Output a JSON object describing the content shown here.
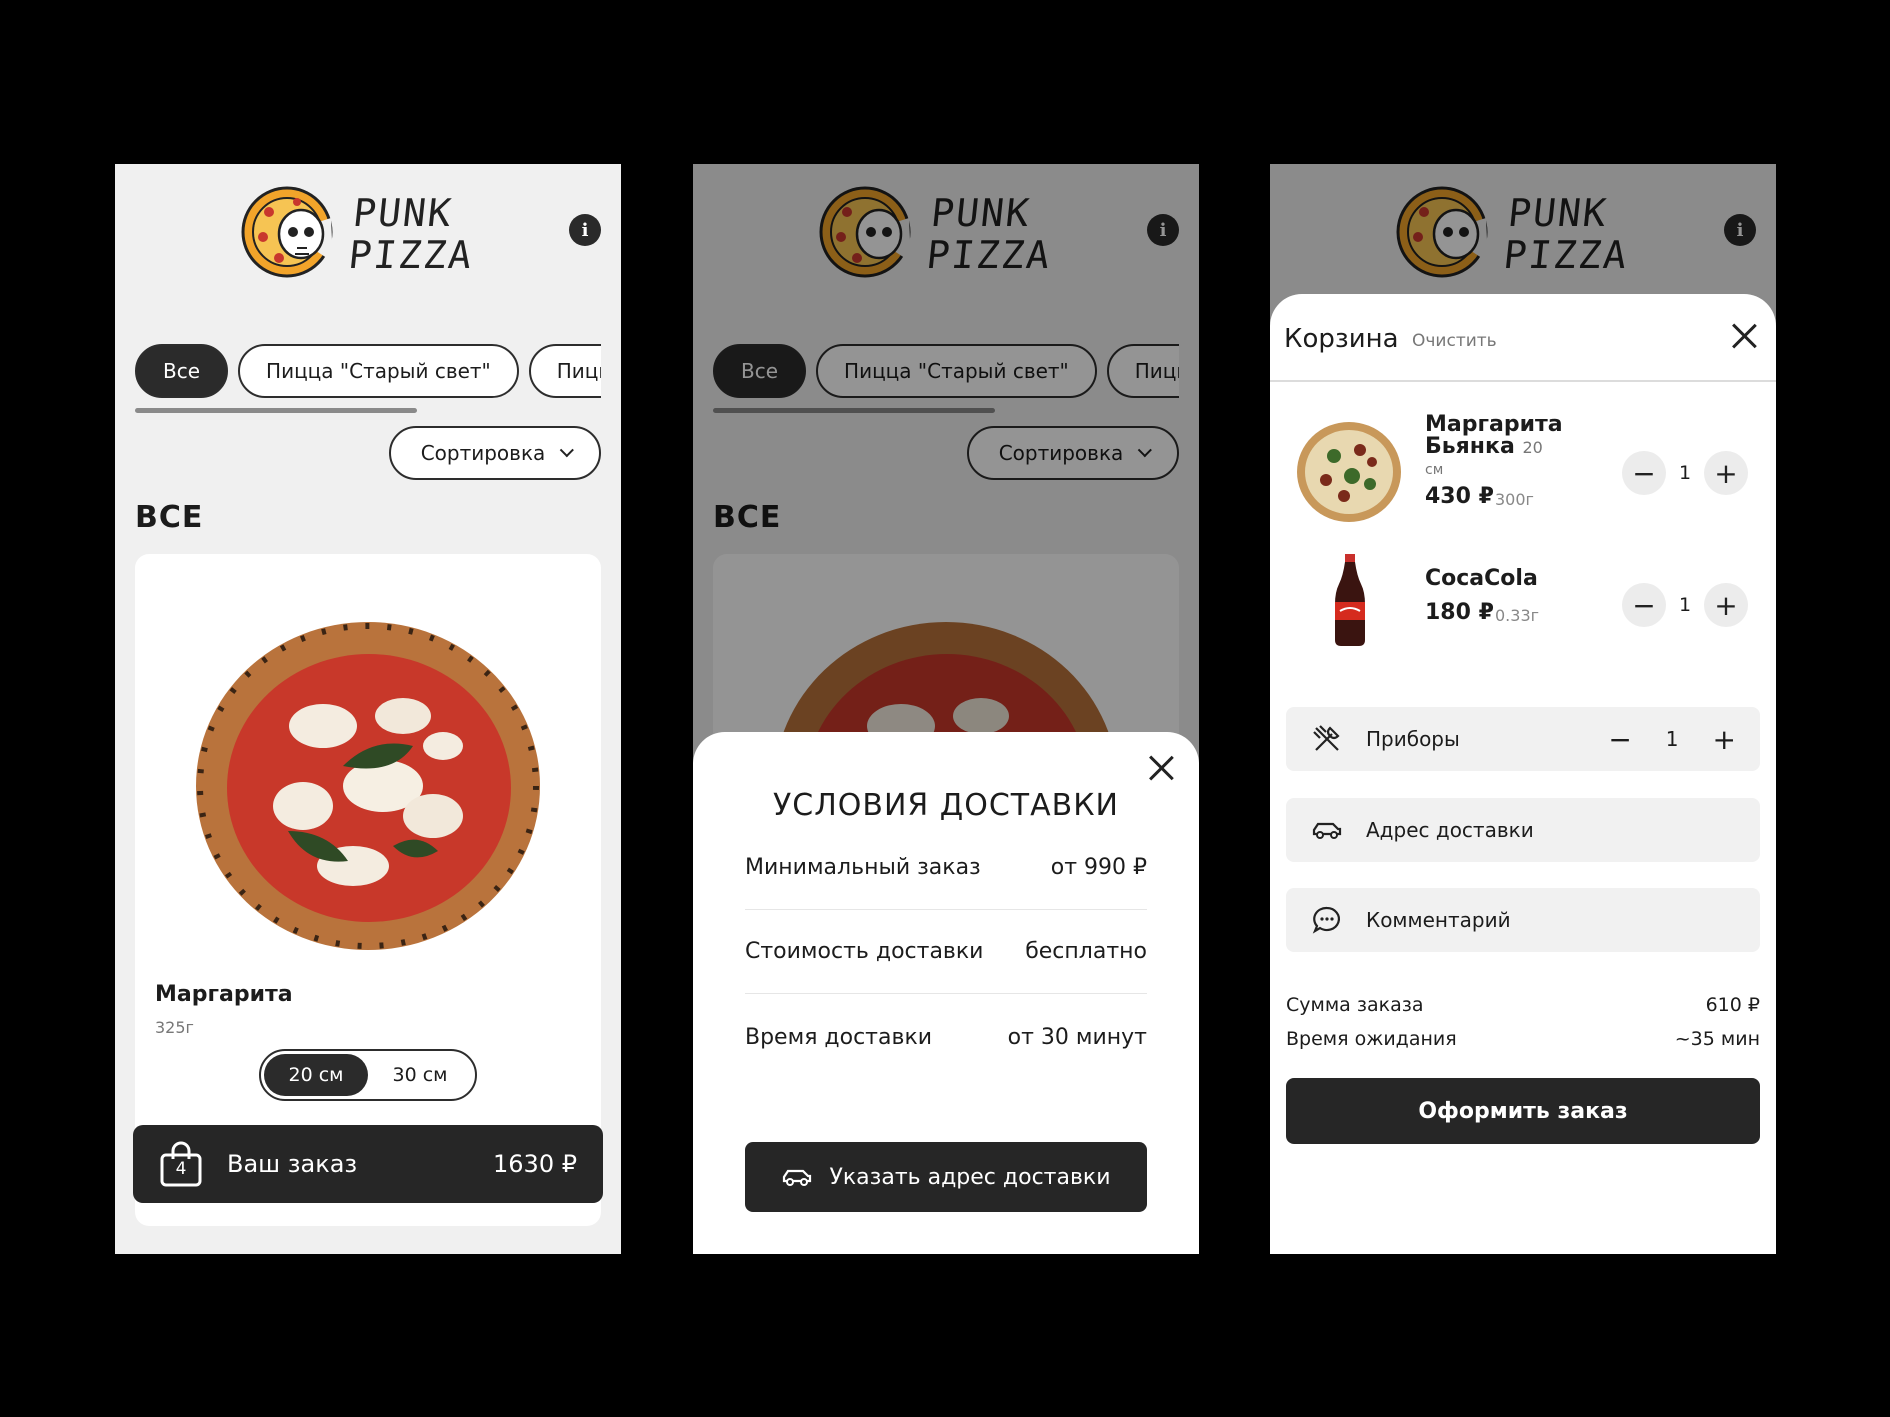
{
  "brand": {
    "line1": "PUNK",
    "line2": "PIZZA"
  },
  "info_label": "i",
  "categories": [
    "Все",
    "Пицца \"Старый свет\"",
    "Пицца"
  ],
  "sort_label": "Сортировка",
  "section_title": "ВСЕ",
  "product": {
    "name": "Маргарита",
    "weight": "325г",
    "sizes": [
      "20 см",
      "30 см"
    ],
    "selected_size": "20 см"
  },
  "order_bar": {
    "count": "4",
    "label": "Ваш заказ",
    "total": "1630 ₽"
  },
  "delivery": {
    "title": "УСЛОВИЯ ДОСТАВКИ",
    "rows": [
      {
        "label": "Минимальный заказ",
        "value": "от 990 ₽"
      },
      {
        "label": "Стоимость доставки",
        "value": "бесплатно"
      },
      {
        "label": "Время доставки",
        "value": "от 30 минут"
      }
    ],
    "cta": "Указать адрес доставки"
  },
  "cart": {
    "title": "Корзина",
    "clear": "Очистить",
    "items": [
      {
        "name_line1": "Маргарита",
        "name_line2": "Бьянка",
        "size_num": "20",
        "size_unit": "см",
        "price": "430 ₽",
        "weight": "300г",
        "qty": "1"
      },
      {
        "name_line1": "CocaCola",
        "price": "180 ₽",
        "weight": "0.33г",
        "qty": "1"
      }
    ],
    "cutlery": {
      "label": "Приборы",
      "qty": "1"
    },
    "address_label": "Адрес доставки",
    "comment_label": "Комментарий",
    "sum_label": "Сумма заказа",
    "sum_value": "610 ₽",
    "wait_label": "Время ожидания",
    "wait_value": "~35 мин",
    "checkout": "Оформить заказ"
  },
  "stepper_minus": "−",
  "stepper_plus": "+"
}
